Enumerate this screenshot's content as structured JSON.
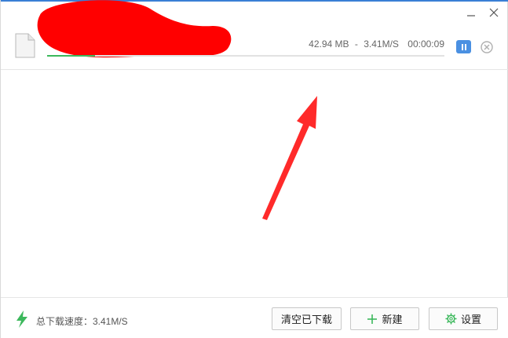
{
  "window": {
    "minimize_label": "minimize",
    "close_label": "close"
  },
  "task": {
    "file_name": "",
    "size": "42.94 MB",
    "separator": "-",
    "speed": "3.41M/S",
    "elapsed": "00:00:09",
    "progress_fraction": 0.12,
    "status": "downloading"
  },
  "footer": {
    "total_speed_label": "总下载速度：3.41M/S",
    "clear_button": "清空已下载",
    "new_button": "新建",
    "settings_button": "设置"
  },
  "colors": {
    "accent": "#4a90e2",
    "progress": "#3cb85c",
    "annotation": "#ff2a2a",
    "redaction": "#ff0000"
  },
  "icons": {
    "file": "file-icon",
    "pause": "pause-icon",
    "remove": "remove-icon",
    "speed": "lightning-icon",
    "new": "plus-icon",
    "settings": "gear-icon"
  }
}
